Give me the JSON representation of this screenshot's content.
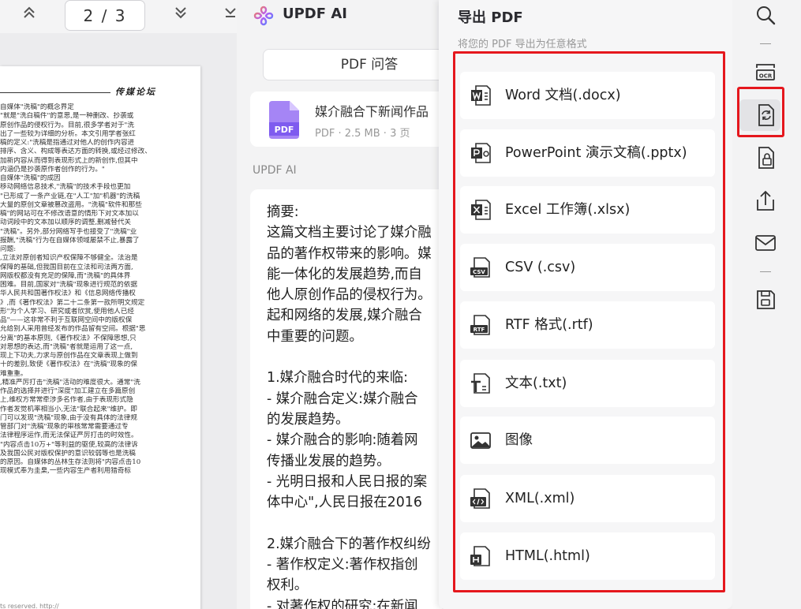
{
  "viewer": {
    "page_current": "2",
    "page_total": "3",
    "page_display": "2 / 3",
    "journal_name": "传媒论坛",
    "body_lines": [
      "自媒体\"洗稿\"的概念界定",
      "\"就是\"洗白稿件\"的意思,是一种删改、抄袭或",
      "原创作品的侵权行为。目前,很多学者对于\"洗",
      "出了一些较为详细的分析。本文引用学者张红",
      "稿的定义:\"洗稿是指通过对他人的创作内容进",
      "排序、含义、构成等表达方面的转换,或经过修改、",
      "加新内容从而得到表现形式上的新创作,但其中",
      "内涵仍是抄袭原作者创作的行为。\"",
      "自媒体\"洗稿\"的成因",
      "移动网络信息技术,\"洗稿\"的技术手段也更加",
      "\"已形成了一条产业链,在\"人工\"加\"机器\"的洗稿",
      "大量的原创文章被篡改盗用。\"洗稿\"软件和那些",
      "稿\"的网站可在不修改语意的情形下对文本加以",
      "动词段中的文本加以顺序的调整,删减替代关",
      "\"洗稿\"。另外,部分网络写手也接受了\"洗稿\"业",
      "报酬,\"洗稿\"行为在自媒体领域屡禁不止,暴露了",
      "问题:",
      ",立法对原创者知识产权保障不够健全。法治是",
      "保障的基础,但我国目前在立法和司法两方面,",
      "网版权都没有充足的保障,而\"洗稿\"的具体界",
      "困难。目前,国家对\"洗稿\"现象进行规范的依据",
      "华人民共和国著作权法》和《信息网络传播权",
      "》,而《著作权法》第二十二条第一款所明文规定",
      "形\"为个人学习、研究或者欣赏,使用他人已经",
      "品\"——这非常不利于互联网空间中的版权保",
      "允给别人采用曾经发布的作品留有空间。根据\"思",
      "分离\"的基本原则,《著作权法》不保障思想,只",
      "对思想的表达,而\"洗稿\"者就是运用了这一点,",
      "现上下功夫,力求与原创作品在文章表现上做到",
      "十的差别,致使《著作权法》在\"洗稿\"现象的保",
      "难重重。",
      ",精准严厉打击\"洗稿\"活动的难度很大。通常\"洗",
      "作品的选择并进行\"深度\"加工建立在多篇原创",
      "上,维权方常常牵涉多名作者,由于表现形式隐",
      "作者发觉机率相当小,无法\"联合起来\"维护。即",
      "门可以发现\"洗稿\"现象,由于没有具体的法律规",
      "管部门对\"洗稿\"现象的审核常常需要通过专",
      "法律程序运作,而无法保证严厉打击的时效性。",
      "\"内容点击10万+\"等利益的驱使,较高的法律诉",
      "及我国公民对版权保护的意识较弱等也是洗稿",
      "的原因。自媒体的丛林生存法则将\"内容点击10",
      "现模式奉为圭臬,一些内容生产者利用猎奇标"
    ],
    "footer": "ts reserved.    http://"
  },
  "ai": {
    "title": "UPDF AI",
    "qa_tab": "PDF 问答",
    "doc_name": "媒介融合下新闻作品",
    "doc_meta": "PDF · 2.5 MB · 3 页",
    "label": "UPDF AI",
    "answer_lines": [
      "摘要:",
      "这篇文档主要讨论了媒介融",
      "品的著作权带来的影响。媒",
      "能一体化的发展趋势,而自",
      "他人原创作品的侵权行为。",
      "起和网络的发展,媒介融合",
      "中重要的问题。",
      "",
      "1.媒介融合时代的来临:",
      "- 媒介融合定义:媒介融合",
      "的发展趋势。",
      "- 媒介融合的影响:随着网",
      "传播业发展的趋势。",
      "- 光明日报和人民日报的案",
      "体中心\",人民日报在2016",
      "",
      "2.媒介融合下的著作权纠纷",
      "- 著作权定义:著作权指创",
      "权利。",
      "- 对著作权的研究:在新闻"
    ]
  },
  "export": {
    "title": "导出 PDF",
    "subtitle": "将您的 PDF 导出为任意格式",
    "formats": [
      {
        "label": "Word 文档(.docx)",
        "icon": "word-icon"
      },
      {
        "label": "PowerPoint 演示文稿(.pptx)",
        "icon": "powerpoint-icon"
      },
      {
        "label": "Excel 工作簿(.xlsx)",
        "icon": "excel-icon"
      },
      {
        "label": "CSV (.csv)",
        "icon": "csv-icon"
      },
      {
        "label": "RTF 格式(.rtf)",
        "icon": "rtf-icon"
      },
      {
        "label": "文本(.txt)",
        "icon": "text-icon"
      },
      {
        "label": "图像",
        "icon": "image-icon"
      },
      {
        "label": "XML(.xml)",
        "icon": "xml-icon"
      },
      {
        "label": "HTML(.html)",
        "icon": "html-icon"
      }
    ],
    "icon_text": {
      "csv": "CSV",
      "rtf": "RTF",
      "ocr": "OCR",
      "pdf": "PDF"
    }
  },
  "sidebar": {
    "items": [
      "search-icon",
      "ocr-icon",
      "convert-icon",
      "protect-icon",
      "share-icon",
      "mail-icon",
      "save-icon"
    ]
  },
  "colors": {
    "highlight": "#e5171d",
    "pdf_badge": "#7e5bef"
  }
}
